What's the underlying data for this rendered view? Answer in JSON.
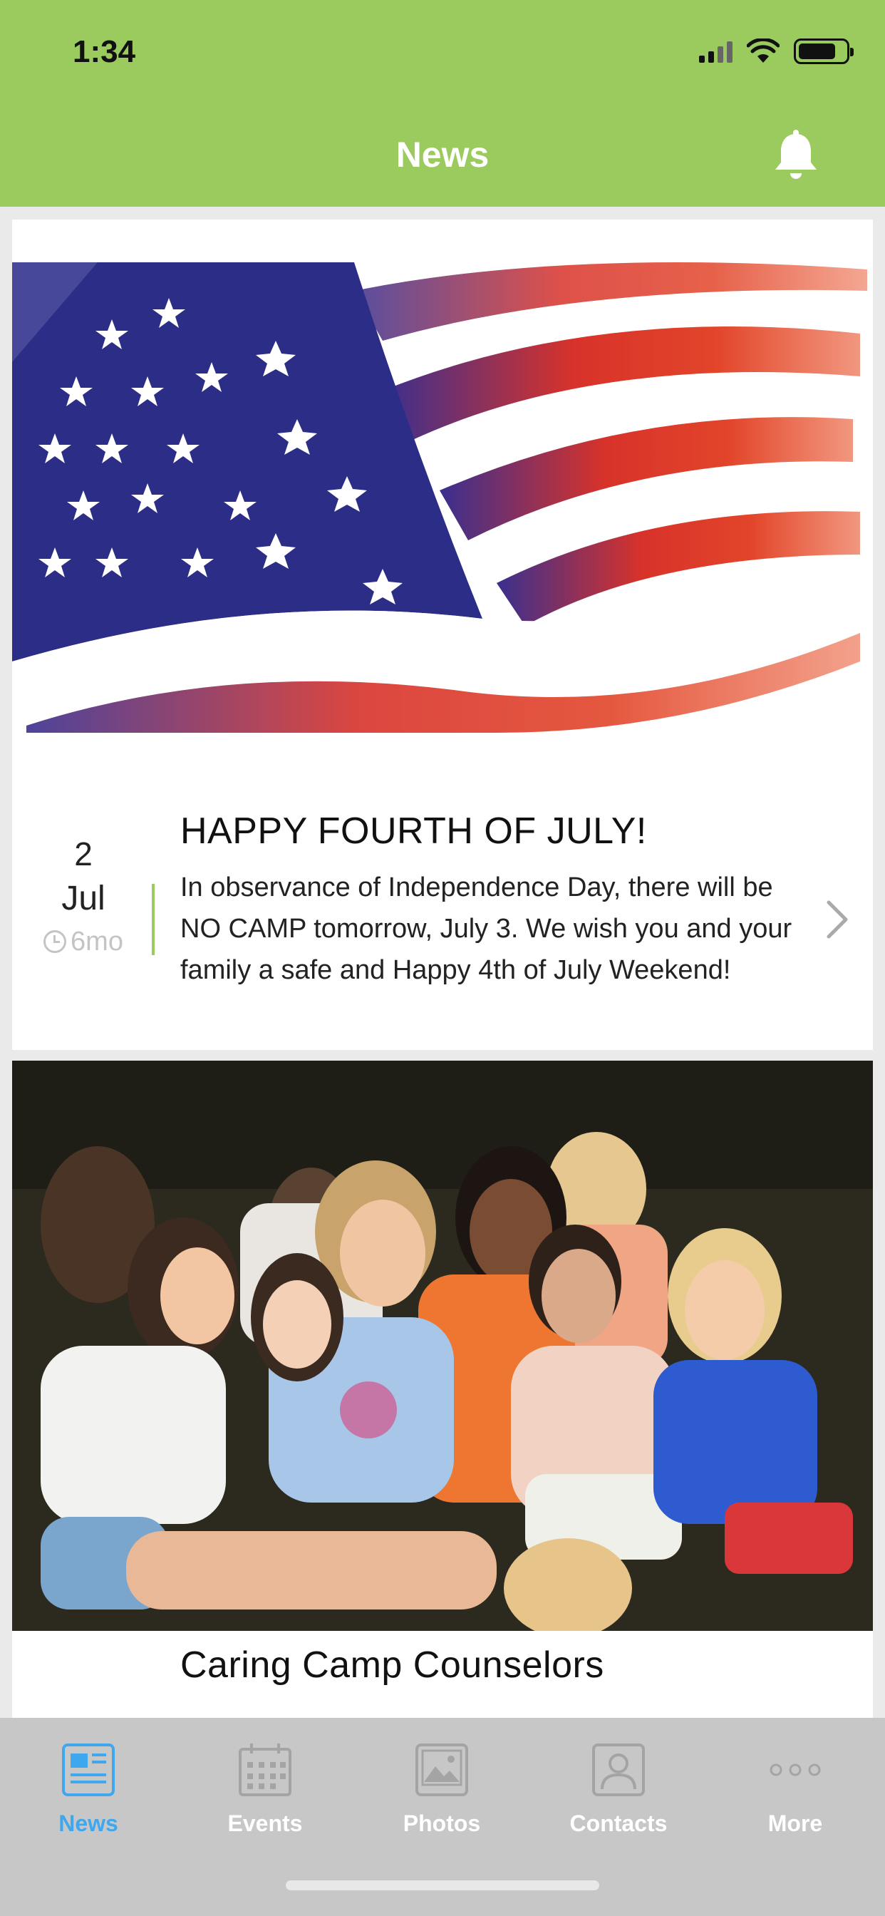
{
  "status_bar": {
    "time": "1:34"
  },
  "nav": {
    "title": "News"
  },
  "posts": [
    {
      "day": "2",
      "month": "Jul",
      "ago": "6mo",
      "title": "HAPPY FOURTH OF JULY!",
      "body": "In observance of Independence Day, there will be NO CAMP tomorrow, July 3. We wish you and your family a safe and Happy 4th of July Weekend!"
    },
    {
      "title": "Caring Camp Counselors"
    }
  ],
  "tabs": [
    {
      "label": "News",
      "icon": "news-icon",
      "active": true
    },
    {
      "label": "Events",
      "icon": "calendar-icon",
      "active": false
    },
    {
      "label": "Photos",
      "icon": "photo-icon",
      "active": false
    },
    {
      "label": "Contacts",
      "icon": "contact-icon",
      "active": false
    },
    {
      "label": "More",
      "icon": "more-icon",
      "active": false
    }
  ],
  "colors": {
    "accent_green": "#9bcb5e",
    "active_tab_blue": "#3fa7ee",
    "tab_bar_gray": "#c7c7c7"
  }
}
